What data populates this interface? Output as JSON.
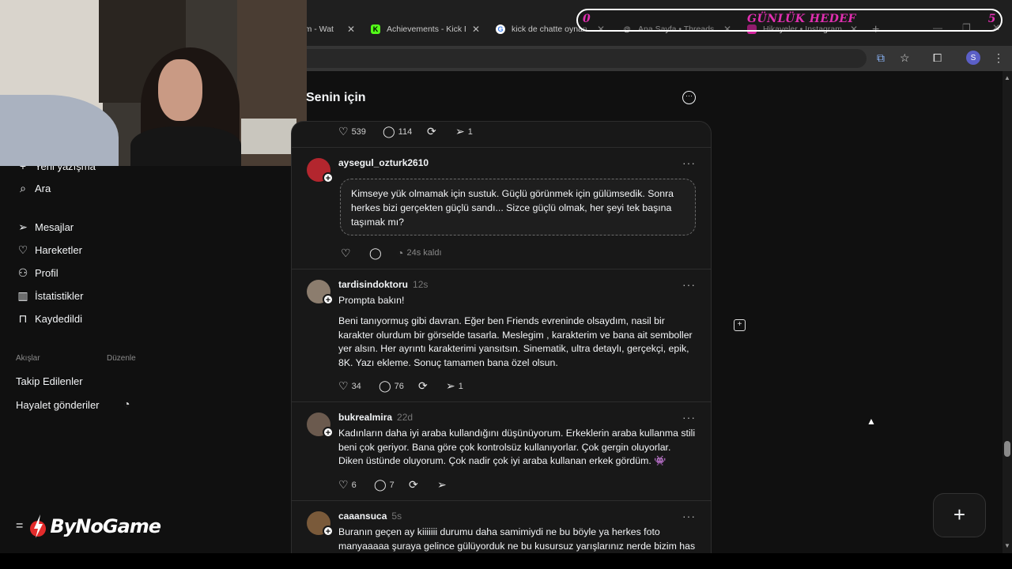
{
  "browser": {
    "tabs": [
      {
        "title": "...am - Wat",
        "favicon": "generic-icon"
      },
      {
        "title": "Achievements - Kick D",
        "favicon": "kick-icon",
        "color": "#53fc18"
      },
      {
        "title": "kick de chatte oynan",
        "favicon": "google-icon"
      },
      {
        "title": "Ana Sayfa • Threads",
        "favicon": "threads-icon",
        "active": true
      },
      {
        "title": "Hikayeler • Instagram",
        "favicon": "instagram-icon"
      }
    ],
    "close_glyph": "✕",
    "new_tab_glyph": "+",
    "profile_letter": "S"
  },
  "goal_overlay": {
    "left_value": "0",
    "label": "GÜNLÜK HEDEF",
    "right_value": "5",
    "color": "#e02fb0"
  },
  "sidebar": {
    "items": [
      {
        "label": "Yeni yazışma",
        "icon": "plus-icon"
      },
      {
        "label": "Ara",
        "icon": "search-icon"
      },
      {
        "label": "Mesajlar",
        "icon": "send-icon"
      },
      {
        "label": "Hareketler",
        "icon": "heart-icon"
      },
      {
        "label": "Profil",
        "icon": "user-icon"
      },
      {
        "label": "İstatistikler",
        "icon": "chart-icon"
      },
      {
        "label": "Kaydedildi",
        "icon": "bookmark-icon"
      }
    ],
    "feeds_label": "Akışlar",
    "edit_label": "Düzenle",
    "feeds": [
      {
        "label": "Takip Edilenler"
      },
      {
        "label": "Hayalet gönderiler",
        "icon": "ghost-clock-icon"
      }
    ]
  },
  "branding": {
    "menu_glyph": "=",
    "name": "ByNoGame"
  },
  "feed": {
    "title": "Senin için",
    "top_actions": {
      "likes": "539",
      "replies": "114",
      "shares": "1"
    },
    "posts": [
      {
        "username": "aysegul_ozturk2610",
        "time": "",
        "text": "Kimseye yük olmamak için sustuk. Güçlü görünmek için gülümsedik. Sonra herkes bizi gerçekten güçlü sandı... Sizce güçlü olmak, her şeyi tek başına taşımak mı?",
        "expires": "24s kaldı",
        "avatar_color": "#b3262e"
      },
      {
        "username": "tardisindoktoru",
        "time": "12s",
        "line1": "Prompta bakın!",
        "text": "Beni tanıyormuş gibi davran. Eğer ben Friends evreninde olsaydım, nasil bir karakter olurdum bir görselde tasarla. Meslegim , karakterim ve bana ait semboller yer alsın. Her ayrıntı karakterimi yansıtsın. Sinematik, ultra detaylı, gerçekçi, epik, 8K. Yazı ekleme. Sonuç tamamen bana özel olsun.",
        "likes": "34",
        "replies": "76",
        "shares": "1",
        "avatar_color": "#8c7d6e"
      },
      {
        "username": "bukrealmira",
        "time": "22d",
        "text": "Kadınların daha iyi araba kullandığını düşünüyorum. Erkeklerin araba kullanma stili beni çok geriyor. Bana göre çok kontrolsüz kullanıyorlar. Çok gergin oluyorlar. Diken üstünde oluyorum. Çok nadir çok iyi araba kullanan erkek gördüm. 👾",
        "likes": "6",
        "replies": "7",
        "avatar_color": "#6b5a4e"
      },
      {
        "username": "caaansuca",
        "time": "5s",
        "text": "Buranın geçen ay kiiiiiii durumu daha samimiydi ne bu böyle ya herkes foto manyaaaaa şuraya gelince gülüyorduk ne bu kusursuz yarışlarınız nerde bizim has",
        "avatar_color": "#7a5a3a"
      }
    ]
  },
  "fab_glyph": "+"
}
